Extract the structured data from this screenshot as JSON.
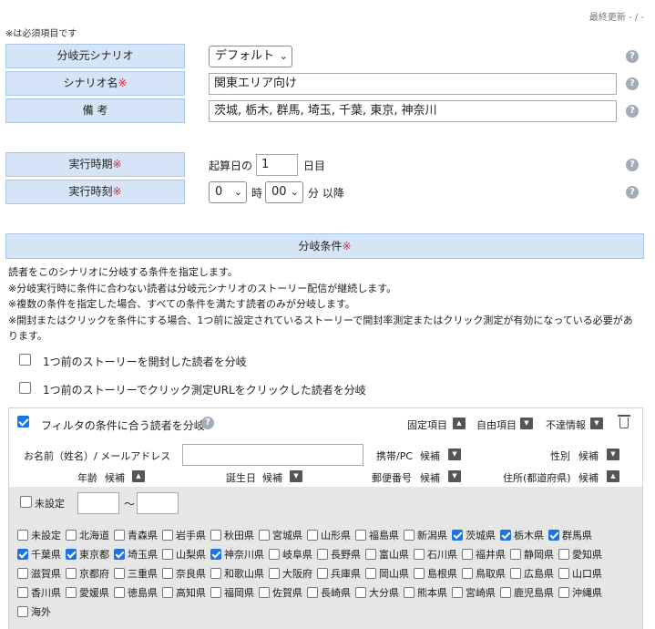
{
  "header": {
    "last_updated": "最終更新 - / -",
    "required_note": "※は必須項目です"
  },
  "form": {
    "source_scenario": {
      "label": "分岐元シナリオ",
      "value": "デフォルト"
    },
    "scenario_name": {
      "label": "シナリオ名",
      "value": "関東エリア向け"
    },
    "memo": {
      "label": "備 考",
      "value": "茨城, 栃木, 群馬, 埼玉, 千葉, 東京, 神奈川"
    },
    "timing": {
      "label": "実行時期",
      "prefix": "起算日の",
      "value": "1",
      "suffix": "日目"
    },
    "time": {
      "label": "実行時刻",
      "hour": "0",
      "hour_unit": "時",
      "minute": "00",
      "suffix": "分 以降"
    }
  },
  "conditions": {
    "header": "分岐条件",
    "required_mark": "※",
    "help_mark": "?",
    "desc": [
      "読者をこのシナリオに分岐する条件を指定します。",
      "※分岐実行時に条件に合わない読者は分岐元シナリオのストーリー配信が継続します。",
      "※複数の条件を指定した場合、すべての条件を満たす読者のみが分岐します。",
      "※開封またはクリックを条件にする場合、1つ前に設定されているストーリーで開封率測定またはクリック測定が有効になっている必要があ",
      "ります。"
    ],
    "opt_open": "1つ前のストーリーを開封した読者を分岐",
    "opt_click": "1つ前のストーリーでクリック測定URLをクリックした読者を分岐",
    "filter": {
      "label": "フィルタの条件に合う読者を分岐",
      "tabs": [
        "固定項目",
        "自由項目",
        "不達情報"
      ],
      "name_email_label": "お名前（姓名）/ メールアドレス",
      "phone_label": "携帯/PC",
      "gender_label": "性別",
      "age_label": "年齢",
      "birthday_label": "誕生日",
      "zipcode_label": "郵便番号",
      "address_label": "住所(都道府県)",
      "candidate": "候補",
      "age_unset": "未設定",
      "tilde": "～"
    },
    "prefectures": [
      {
        "name": "未設定",
        "checked": false
      },
      {
        "name": "北海道",
        "checked": false
      },
      {
        "name": "青森県",
        "checked": false
      },
      {
        "name": "岩手県",
        "checked": false
      },
      {
        "name": "秋田県",
        "checked": false
      },
      {
        "name": "宮城県",
        "checked": false
      },
      {
        "name": "山形県",
        "checked": false
      },
      {
        "name": "福島県",
        "checked": false
      },
      {
        "name": "新潟県",
        "checked": false
      },
      {
        "name": "茨城県",
        "checked": true
      },
      {
        "name": "栃木県",
        "checked": true
      },
      {
        "name": "群馬県",
        "checked": true
      },
      {
        "name": "千葉県",
        "checked": true
      },
      {
        "name": "東京都",
        "checked": true
      },
      {
        "name": "埼玉県",
        "checked": true
      },
      {
        "name": "山梨県",
        "checked": false
      },
      {
        "name": "神奈川県",
        "checked": true
      },
      {
        "name": "岐阜県",
        "checked": false
      },
      {
        "name": "長野県",
        "checked": false
      },
      {
        "name": "富山県",
        "checked": false
      },
      {
        "name": "石川県",
        "checked": false
      },
      {
        "name": "福井県",
        "checked": false
      },
      {
        "name": "静岡県",
        "checked": false
      },
      {
        "name": "愛知県",
        "checked": false
      },
      {
        "name": "滋賀県",
        "checked": false
      },
      {
        "name": "京都府",
        "checked": false
      },
      {
        "name": "三重県",
        "checked": false
      },
      {
        "name": "奈良県",
        "checked": false
      },
      {
        "name": "和歌山県",
        "checked": false
      },
      {
        "name": "大阪府",
        "checked": false
      },
      {
        "name": "兵庫県",
        "checked": false
      },
      {
        "name": "岡山県",
        "checked": false
      },
      {
        "name": "島根県",
        "checked": false
      },
      {
        "name": "鳥取県",
        "checked": false
      },
      {
        "name": "広島県",
        "checked": false
      },
      {
        "name": "山口県",
        "checked": false
      },
      {
        "name": "香川県",
        "checked": false
      },
      {
        "name": "愛媛県",
        "checked": false
      },
      {
        "name": "徳島県",
        "checked": false
      },
      {
        "name": "高知県",
        "checked": false
      },
      {
        "name": "福岡県",
        "checked": false
      },
      {
        "name": "佐賀県",
        "checked": false
      },
      {
        "name": "長崎県",
        "checked": false
      },
      {
        "name": "大分県",
        "checked": false
      },
      {
        "name": "熊本県",
        "checked": false
      },
      {
        "name": "宮崎県",
        "checked": false
      },
      {
        "name": "鹿児島県",
        "checked": false
      },
      {
        "name": "沖縄県",
        "checked": false
      },
      {
        "name": "海外",
        "checked": false
      }
    ]
  },
  "colors": {
    "label_bg": "#d5e5f7",
    "required": "#e0203b",
    "checkbox_on": "#1a73e8"
  }
}
